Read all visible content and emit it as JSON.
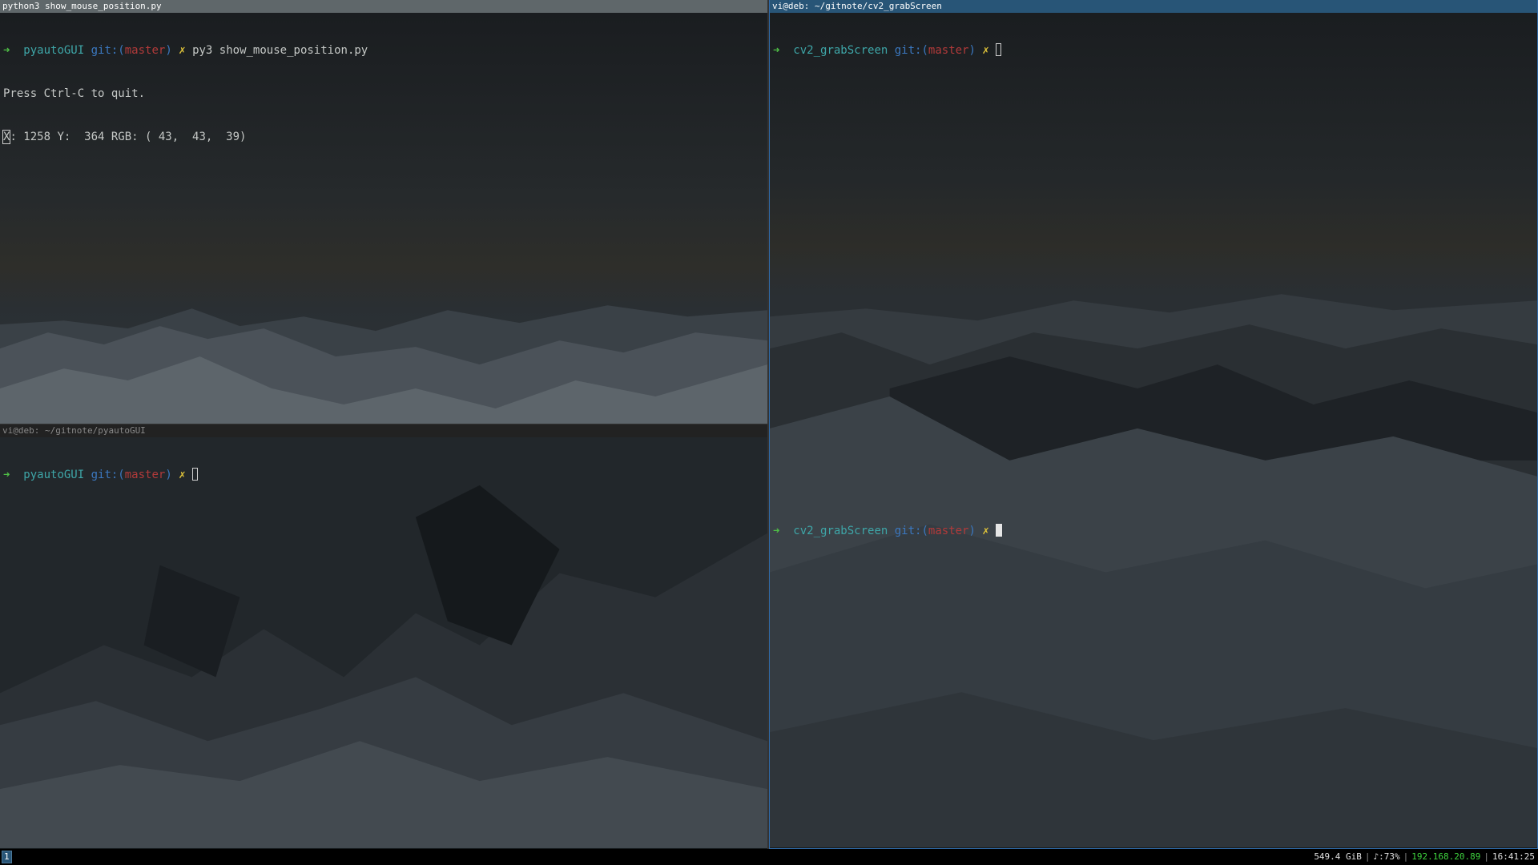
{
  "windows": {
    "top_left": {
      "title": "python3 show_mouse_position.py",
      "lines": {
        "l1": {
          "arrow": "➜",
          "dir": "pyautoGUI",
          "git": "git:(",
          "branch": "master",
          "git_close": ")",
          "dirty": "✗",
          "command": "py3 show_mouse_position.py"
        },
        "l2": "Press Ctrl-C to quit.",
        "l3_first_char": "X",
        "l3_rest": ": 1258 Y:  364 RGB: ( 43,  43,  39)"
      }
    },
    "bottom_left": {
      "title": "vi@deb: ~/gitnote/pyautoGUI",
      "prompt": {
        "arrow": "➜",
        "dir": "pyautoGUI",
        "git": "git:(",
        "branch": "master",
        "git_close": ")",
        "dirty": "✗"
      }
    },
    "right": {
      "title": "vi@deb: ~/gitnote/cv2_grabScreen",
      "prompt1": {
        "arrow": "➜",
        "dir": "cv2_grabScreen",
        "git": "git:(",
        "branch": "master",
        "git_close": ")",
        "dirty": "✗"
      },
      "prompt2": {
        "arrow": "➜",
        "dir": "cv2_grabScreen",
        "git": "git:(",
        "branch": "master",
        "git_close": ")",
        "dirty": "✗"
      }
    }
  },
  "statusbar": {
    "workspace": "1",
    "disk": "549.4 GiB",
    "volume": "♪:73%",
    "ip": "192.168.20.89",
    "time": "16:41:25",
    "separator": "|"
  },
  "colors": {
    "active_title": "#285577",
    "inactive_title": "#5f676a",
    "prompt_arrow": "#4fc046",
    "prompt_dir": "#3ea6a8",
    "prompt_git": "#3b78c0",
    "prompt_branch": "#b23a3a",
    "prompt_dirty": "#e0c43a",
    "status_ip": "#3fd43f"
  }
}
